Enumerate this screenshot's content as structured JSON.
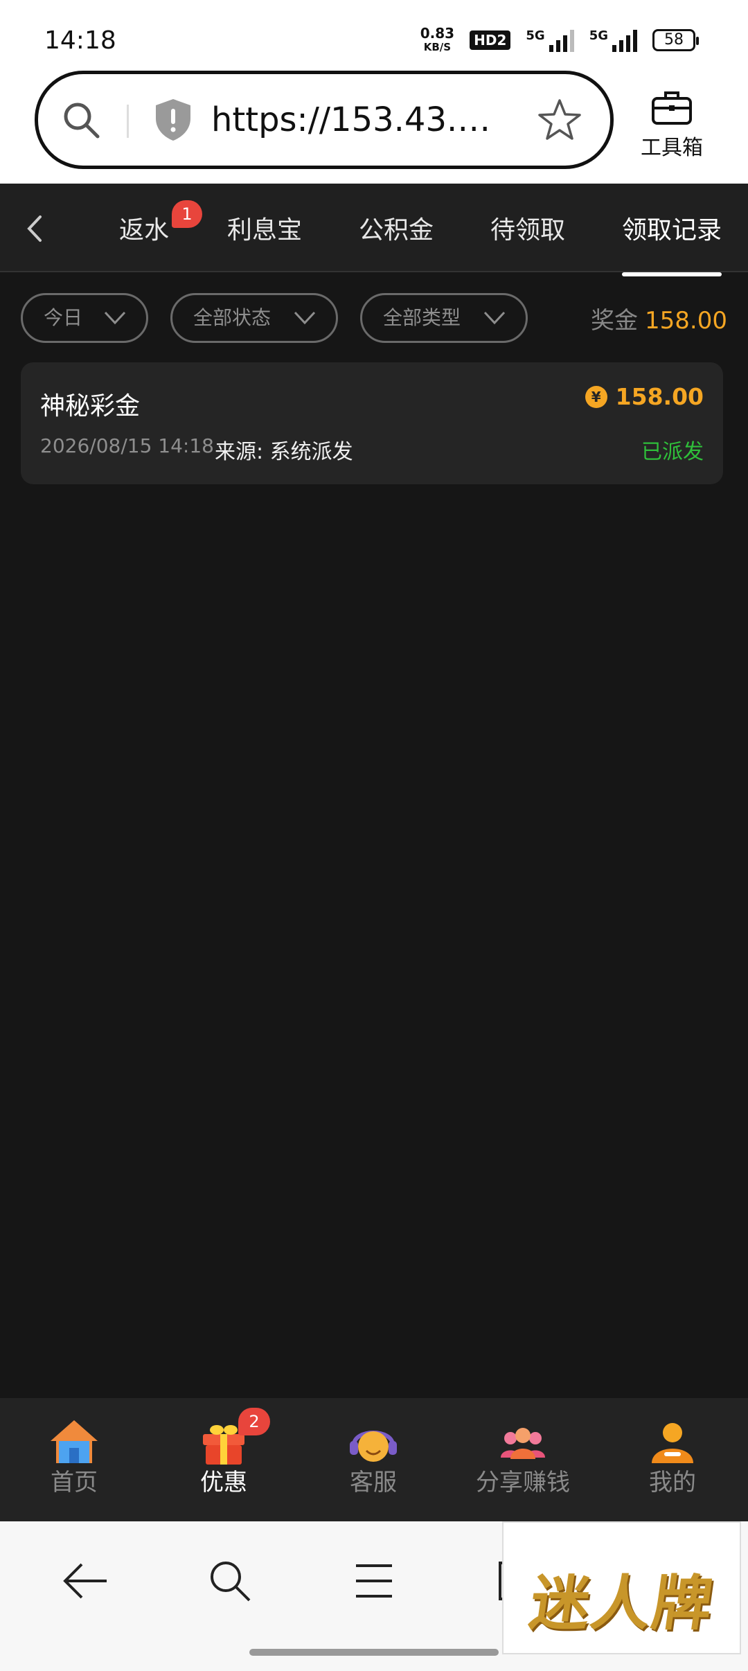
{
  "status_bar": {
    "time": "14:18",
    "speed_value": "0.83",
    "speed_unit": "KB/S",
    "hd_label": "HD2",
    "net1": "5G",
    "net2": "5G",
    "battery": "58"
  },
  "browser": {
    "url": "https://153.43.18...",
    "toolbox_label": "工具箱"
  },
  "tabs": [
    {
      "label": "返水",
      "badge": "1"
    },
    {
      "label": "利息宝"
    },
    {
      "label": "公积金"
    },
    {
      "label": "待领取"
    },
    {
      "label": "领取记录",
      "active": true
    }
  ],
  "filters": {
    "date": "今日",
    "status": "全部状态",
    "type": "全部类型",
    "bonus_label": "奖金",
    "bonus_amount": "158.00"
  },
  "records": [
    {
      "title": "神秘彩金",
      "amount": "158.00",
      "currency_symbol": "¥",
      "datetime": "2026/08/15 14:18",
      "source": "来源: 系统派发",
      "status": "已派发"
    }
  ],
  "bottom_nav": [
    {
      "label": "首页",
      "icon": "home-icon"
    },
    {
      "label": "优惠",
      "icon": "gift-icon",
      "badge": "2",
      "active": true
    },
    {
      "label": "客服",
      "icon": "support-icon"
    },
    {
      "label": "分享赚钱",
      "icon": "share-icon"
    },
    {
      "label": "我的",
      "icon": "profile-icon"
    }
  ],
  "watermark": "迷人牌",
  "colors": {
    "accent": "#f5a623",
    "success": "#2fbf3a",
    "badge": "#e8453c",
    "background": "#161616"
  }
}
